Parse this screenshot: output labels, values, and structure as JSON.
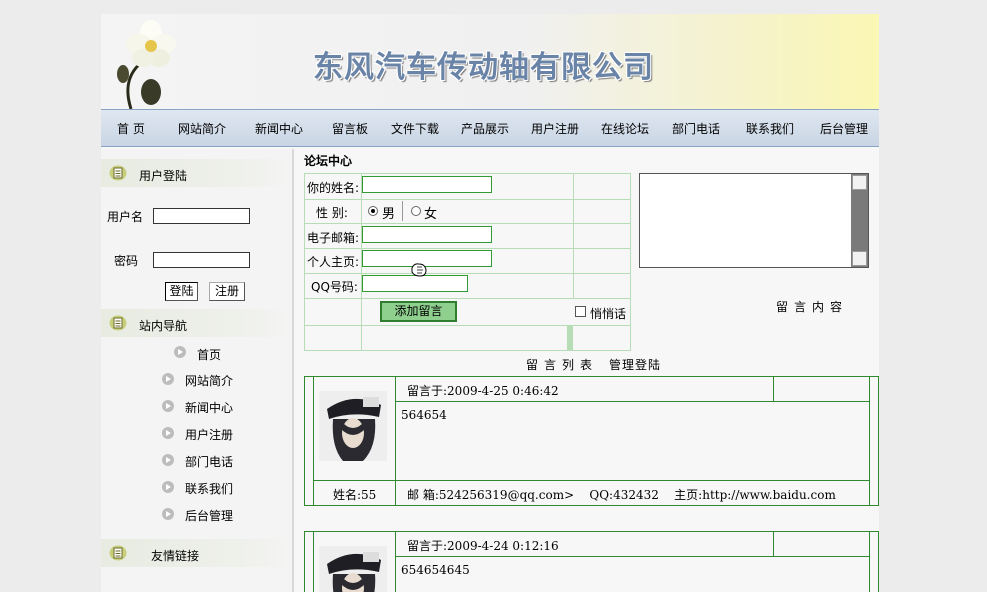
{
  "site": {
    "title": "东风汽车传动轴有限公司"
  },
  "nav": [
    "首 页",
    "网站简介",
    "新闻中心",
    "留言板",
    "文件下载",
    "产品展示",
    "用户注册",
    "在线论坛",
    "部门电话",
    "联系我们",
    "后台管理"
  ],
  "sidebar": {
    "login": {
      "title": "用户登陆",
      "username_label": "用户名",
      "password_label": "密码",
      "login_button": "登陆",
      "register_button": "注册"
    },
    "site_nav": {
      "title": "站内导航",
      "items": [
        "首页",
        "网站简介",
        "新闻中心",
        "用户注册",
        "部门电话",
        "联系我们",
        "后台管理"
      ]
    },
    "links": {
      "title": "友情链接"
    }
  },
  "main": {
    "title": "论坛中心",
    "form": {
      "name_label": "你的姓名:",
      "gender_label": "性 别:",
      "male": "男",
      "female": "女",
      "email_label": "电子邮箱:",
      "homepage_label": "个人主页:",
      "qq_label": "QQ号码:",
      "add_button": "添加留言",
      "whisper_label": "悄悄话",
      "content_label": "留言内容"
    },
    "list_label": "留言列表",
    "admin_login": "管理登陆",
    "messages": [
      {
        "posted": "留言于:2009-4-25 0:46:42",
        "content": "564654",
        "name": "姓名:55",
        "contact": "邮 箱:524256319@qq.com>    QQ:432432    主页:http://www.baidu.com"
      },
      {
        "posted": "留言于:2009-4-24 0:12:16",
        "content": "654654645"
      }
    ]
  },
  "colors": {
    "form_border": "#b7ddb7",
    "message_border": "#2f8a2f",
    "button_green": "#8fd08f",
    "nav_bar": "#c9d5e4"
  },
  "icons": {
    "section": "book-icon",
    "nav_bullet": "arrow-bullet-icon",
    "avatar": "user-avatar-icon",
    "cursor": "hand-cursor-icon"
  }
}
